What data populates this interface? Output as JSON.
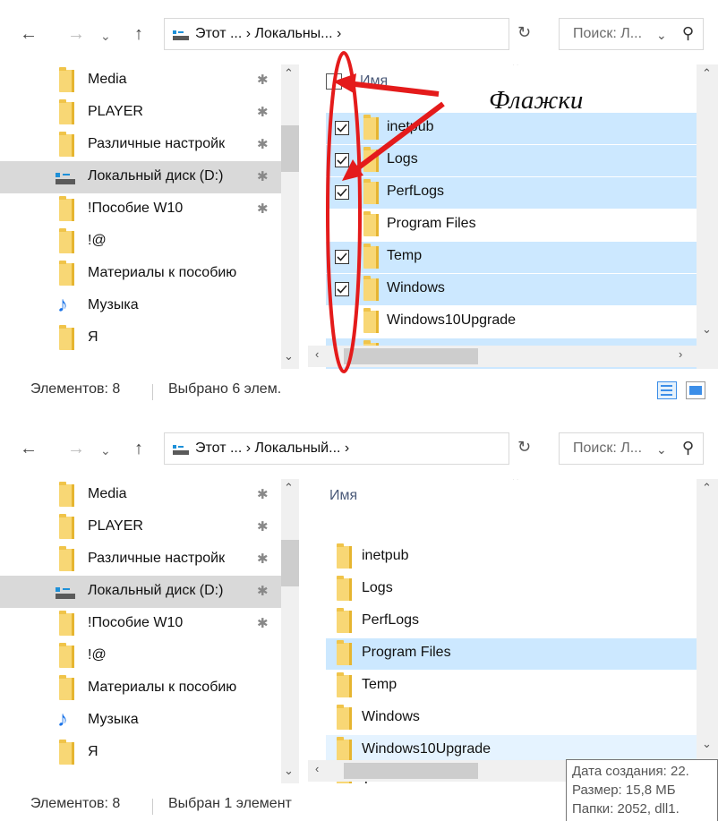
{
  "colors": {
    "selection": "#cce8ff",
    "hover": "#e5f3ff",
    "nav_selected": "#d9d9d9",
    "folder": "#f8d775",
    "annotation": "#e41b1b",
    "accent": "#1e90d8"
  },
  "top": {
    "address": {
      "path": "Этот ... › Локальны... ›",
      "search_placeholder": "Поиск: Л..."
    },
    "nav_items": [
      {
        "label": "Media",
        "icon": "folder-icon",
        "pinned": true
      },
      {
        "label": "PLAYER",
        "icon": "folder-icon",
        "pinned": true
      },
      {
        "label": "Различные настройк",
        "icon": "folder-icon",
        "pinned": true
      },
      {
        "label": "Локальный диск (D:)",
        "icon": "drive-icon",
        "pinned": true,
        "selected": true
      },
      {
        "label": "!Пособие W10",
        "icon": "folder-icon",
        "pinned": true
      },
      {
        "label": "!@",
        "icon": "folder-icon",
        "pinned": false
      },
      {
        "label": "Материалы к пособию",
        "icon": "folder-icon",
        "pinned": false
      },
      {
        "label": "Музыка",
        "icon": "music-icon",
        "pinned": false
      },
      {
        "label": "Я",
        "icon": "folder-icon",
        "pinned": false
      }
    ],
    "column_header": "Имя",
    "files": [
      {
        "name": "inetpub",
        "checked": true
      },
      {
        "name": "Logs",
        "checked": true
      },
      {
        "name": "PerfLogs",
        "checked": true
      },
      {
        "name": "Program Files",
        "checked": false
      },
      {
        "name": "Temp",
        "checked": true
      },
      {
        "name": "Windows",
        "checked": true
      },
      {
        "name": "Windows10Upgrade",
        "checked": false
      },
      {
        "name": "Т",
        "checked": true
      }
    ],
    "status": {
      "count": "Элементов: 8",
      "selection": "Выбрано 6 элем."
    },
    "annotation": "Флажки"
  },
  "bottom": {
    "address": {
      "path": "Этот ... › Локальный... ›",
      "search_placeholder": "Поиск: Л..."
    },
    "nav_items": [
      {
        "label": "Media",
        "icon": "folder-icon",
        "pinned": true
      },
      {
        "label": "PLAYER",
        "icon": "folder-icon",
        "pinned": true
      },
      {
        "label": "Различные настройк",
        "icon": "folder-icon",
        "pinned": true
      },
      {
        "label": "Локальный диск (D:)",
        "icon": "drive-icon",
        "pinned": true,
        "selected": true
      },
      {
        "label": "!Пособие W10",
        "icon": "folder-icon",
        "pinned": true
      },
      {
        "label": "!@",
        "icon": "folder-icon",
        "pinned": false
      },
      {
        "label": "Материалы к пособию",
        "icon": "folder-icon",
        "pinned": false
      },
      {
        "label": "Музыка",
        "icon": "music-icon",
        "pinned": false
      },
      {
        "label": "Я",
        "icon": "folder-icon",
        "pinned": false
      }
    ],
    "column_header": "Имя",
    "files": [
      {
        "name": "inetpub",
        "state": "none"
      },
      {
        "name": "Logs",
        "state": "none"
      },
      {
        "name": "PerfLogs",
        "state": "none"
      },
      {
        "name": "Program Files",
        "state": "selected"
      },
      {
        "name": "Temp",
        "state": "none"
      },
      {
        "name": "Windows",
        "state": "none"
      },
      {
        "name": "Windows10Upgrade",
        "state": "hover"
      },
      {
        "name": "Т",
        "state": "none"
      }
    ],
    "status": {
      "count": "Элементов: 8",
      "selection": "Выбран 1 элемент"
    },
    "tooltip": [
      "Дата создания: 22.",
      "Размер: 15,8 МБ",
      "Папки: 2052, dll1."
    ]
  }
}
